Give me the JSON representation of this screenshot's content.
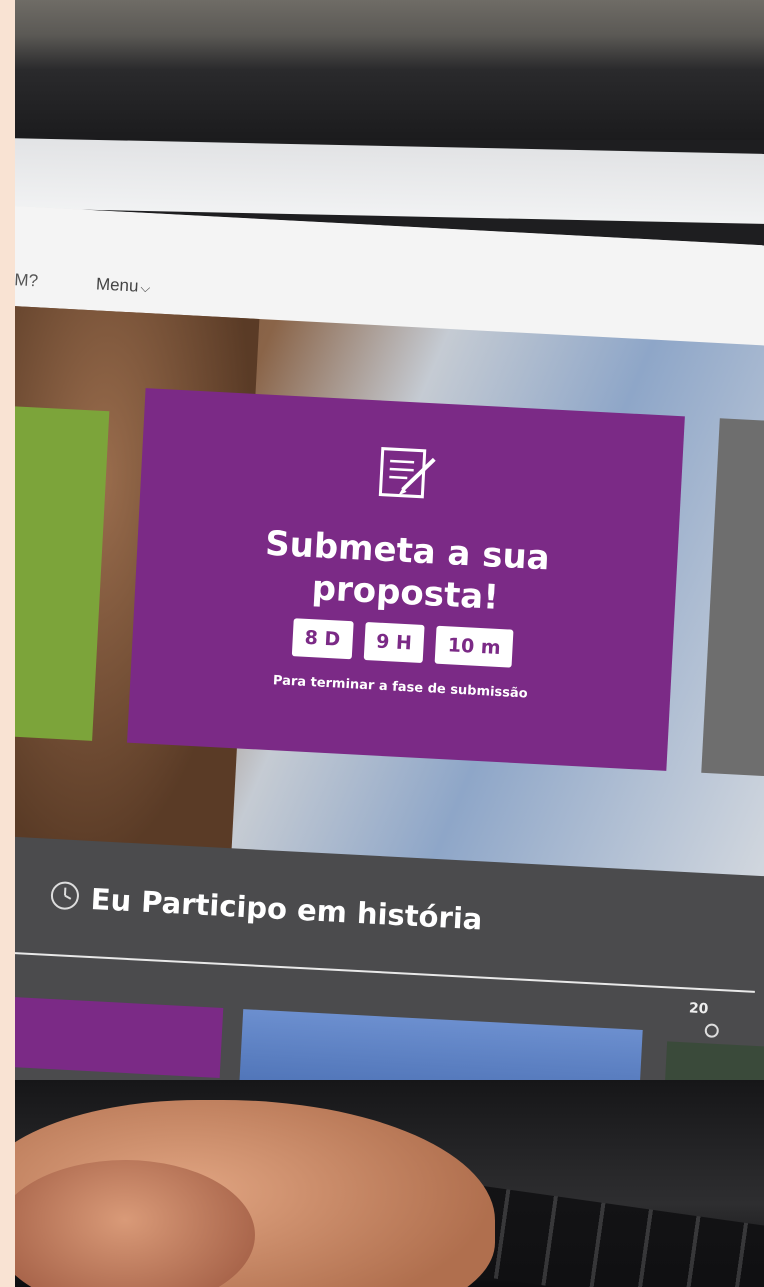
{
  "nav": {
    "pm_label": "PM?",
    "menu_label": "Menu",
    "menu_icon": "chevron-down-icon"
  },
  "proposal_card": {
    "icon": "document-edit-icon",
    "title_line1": "Submeta a sua",
    "title_line2": "proposta!",
    "countdown": [
      "8 D",
      "9 H",
      "10 m"
    ],
    "subtitle": "Para terminar a fase de submissão"
  },
  "history": {
    "icon": "clock-icon",
    "title": "Eu Participo em história",
    "year_fragment": "20"
  },
  "colors": {
    "purple": "#7b2a86",
    "green": "#7ca43a",
    "band_gray": "#4b4b4d"
  }
}
